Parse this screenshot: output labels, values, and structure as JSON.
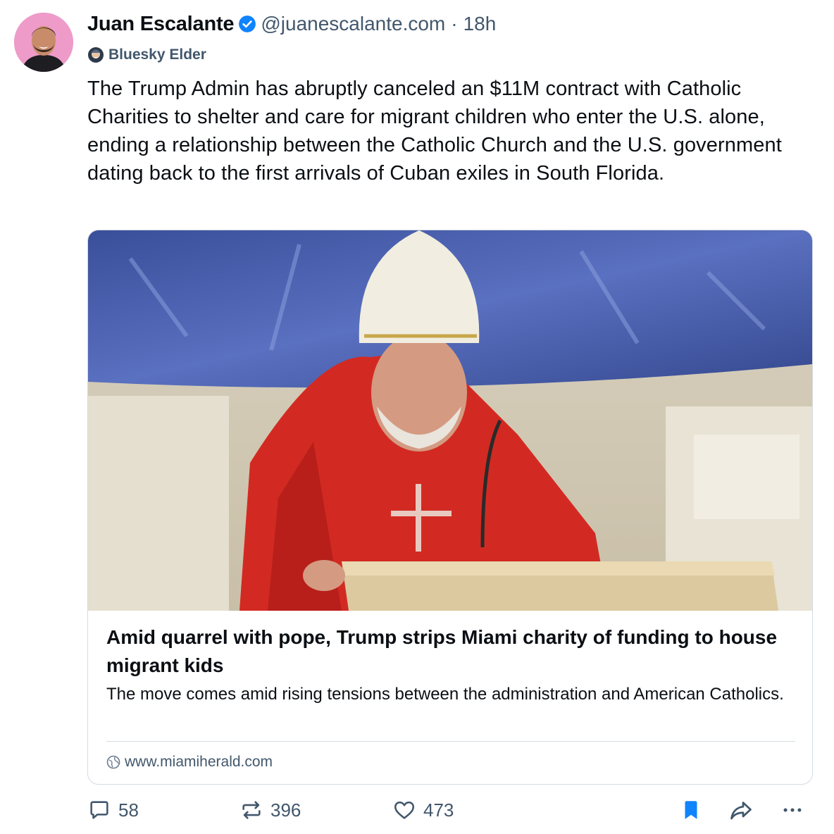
{
  "post": {
    "author_name": "Juan Escalante",
    "handle": "@juanescalante.com",
    "separator": "·",
    "time": "18h",
    "badge": "Bluesky Elder",
    "text": "The Trump Admin has abruptly canceled an $11M contract with Catholic Charities to shelter and care for migrant children who enter the U.S. alone, ending a relationship between the Catholic Church and the U.S. government dating back to the first arrivals of Cuban exiles in South Florida."
  },
  "link_card": {
    "title": "Amid quarrel with pope, Trump strips Miami charity of funding to house migrant kids",
    "description": "The move comes amid rising tensions between the administration and American Catholics.",
    "source": "www.miamiherald.com",
    "image_alt": "Bishop in red vestments and white mitre speaking at a stone pulpit"
  },
  "actions": {
    "replies": "58",
    "reposts": "396",
    "likes": "473"
  },
  "colors": {
    "accent": "#1083fe",
    "muted": "#42576c",
    "avatar_bg": "#ee9bc9",
    "border": "#d4dbe2"
  },
  "icons": [
    "verified-icon",
    "elder-badge-icon",
    "globe-icon",
    "reply-icon",
    "repost-icon",
    "like-icon",
    "bookmark-icon",
    "share-icon",
    "more-icon"
  ]
}
